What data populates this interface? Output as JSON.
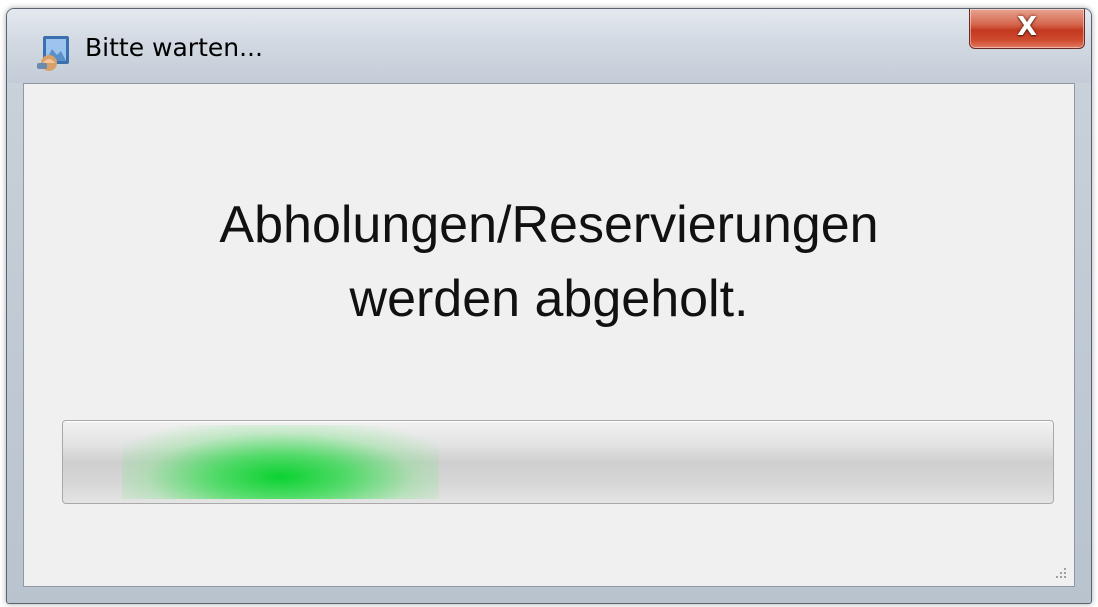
{
  "window": {
    "title": "Bitte warten...",
    "close_label": "X"
  },
  "message": {
    "line1": "Abholungen/Reservierungen",
    "line2": "werden abgeholt."
  },
  "progress": {
    "mode": "marquee",
    "glow_start": 0.06,
    "glow_end": 0.38,
    "color": "#00d22a"
  },
  "icons": {
    "app": "app-icon",
    "close": "close-icon",
    "grip": "resize-grip-icon"
  }
}
